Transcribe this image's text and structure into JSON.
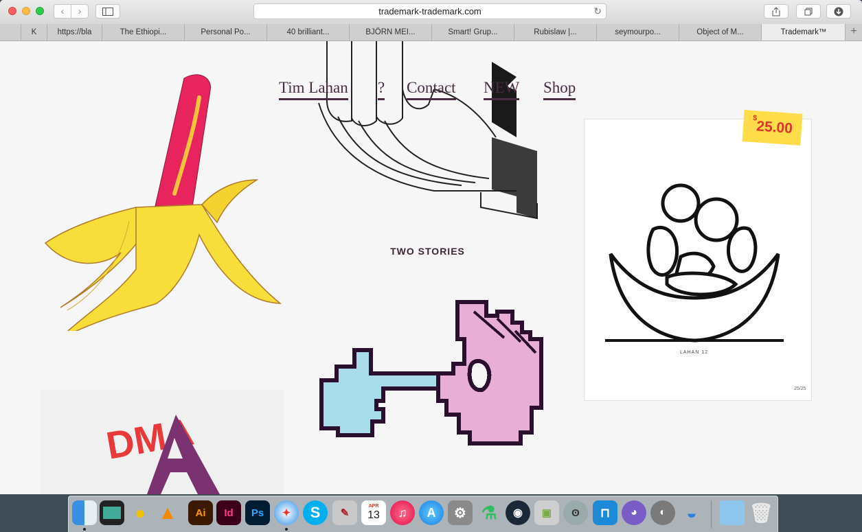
{
  "browser": {
    "url": "trademark-trademark.com",
    "tabs": [
      "K",
      "https://bla",
      "The Ethiopi...",
      "Personal Po...",
      "40 brilliant...",
      "BJÖRN MEI...",
      "Smart! Grup...",
      "Rubislaw |...",
      "seymourpo...",
      "Object of M...",
      "Trademark™"
    ],
    "active_tab": "Trademark™",
    "add_tab_label": "+"
  },
  "site": {
    "nav": [
      "Tim Lahan",
      "?",
      "Contact",
      "NEW",
      "Shop"
    ],
    "section_title": "TWO STORIES",
    "price_symbol": "$",
    "price_amount": "25.00",
    "print_signature": "LAHAN 12",
    "print_edition": "25/25",
    "sticker_text": "DMA"
  },
  "dock": {
    "apps": [
      "Finder",
      "Mission Control",
      "Cyberduck",
      "VLC",
      "Illustrator",
      "InDesign",
      "Photoshop",
      "Safari",
      "Skype",
      "Script Editor",
      "Calendar",
      "iTunes",
      "App Store",
      "System Preferences",
      "Potion",
      "Steam",
      "Preview",
      "Koala",
      "Sketch Frame",
      "GitHub",
      "Sequel Pro",
      "Pages",
      "Downloads",
      "Trash"
    ],
    "calendar_month": "APR",
    "calendar_day": "13"
  },
  "colors": {
    "nav_text": "#4b2a44",
    "price_tag": "#ffdc4a",
    "price_text": "#e0342c",
    "banana": "#f8de3a",
    "hotdog": "#e8245e",
    "pixel_blue": "#a9dcea",
    "pixel_pink": "#e8aed6",
    "pixel_outline": "#2a0f2e"
  }
}
